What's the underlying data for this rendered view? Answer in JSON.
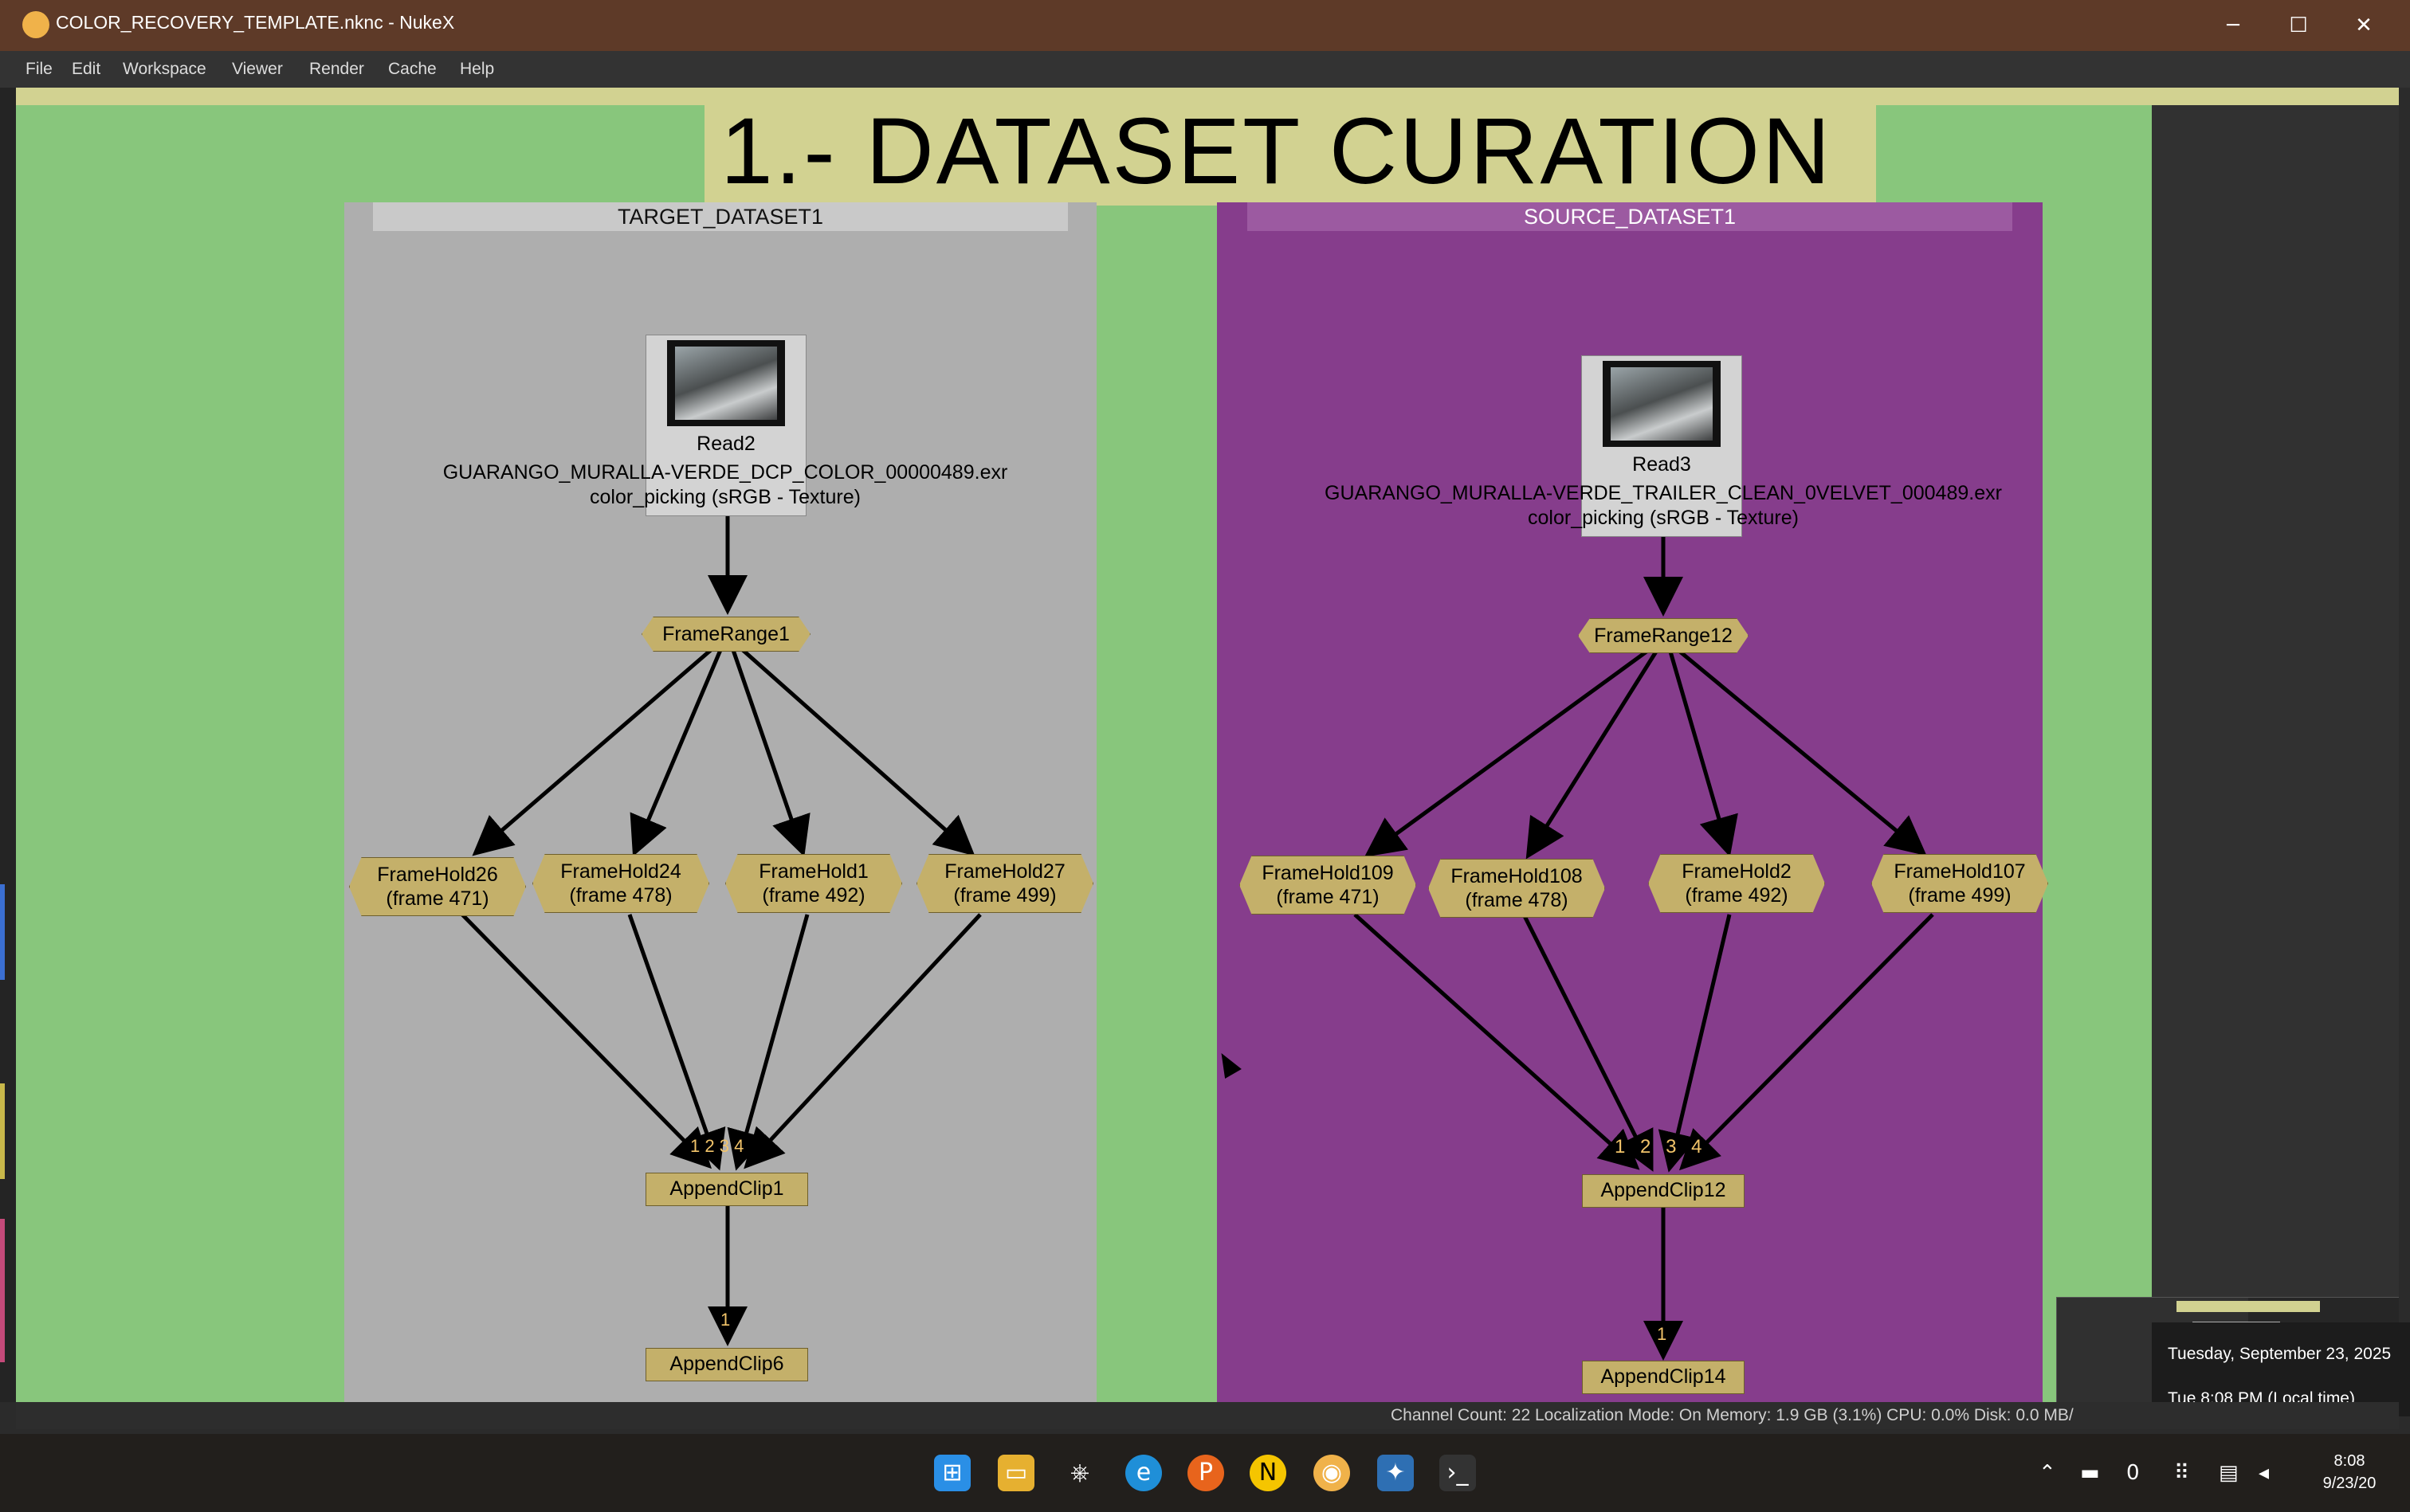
{
  "window": {
    "title": "COLOR_RECOVERY_TEMPLATE.nknc - NukeX",
    "minimize": "─",
    "maximize": "☐",
    "close": "✕"
  },
  "menu": [
    "File",
    "Edit",
    "Workspace",
    "Viewer",
    "Render",
    "Cache",
    "Help"
  ],
  "graph": {
    "title": "1.- DATASET CURATION",
    "target": {
      "label": "TARGET_DATASET1",
      "read": {
        "name": "Read2",
        "file": "GUARANGO_MURALLA-VERDE_DCP_COLOR_00000489.exr",
        "colorspace": "color_picking (sRGB - Texture)"
      },
      "framerange": "FrameRange1",
      "holds": [
        {
          "name": "FrameHold26",
          "frame": "(frame 471)"
        },
        {
          "name": "FrameHold24",
          "frame": "(frame 478)"
        },
        {
          "name": "FrameHold1",
          "frame": "(frame 492)"
        },
        {
          "name": "FrameHold27",
          "frame": "(frame 499)"
        }
      ],
      "inputs": [
        "1",
        "2",
        "3",
        "4"
      ],
      "append1": "AppendClip1",
      "append2": "AppendClip6",
      "append2_input": "1"
    },
    "source": {
      "label": "SOURCE_DATASET1",
      "read": {
        "name": "Read3",
        "file": "GUARANGO_MURALLA-VERDE_TRAILER_CLEAN_0VELVET_000489.exr",
        "colorspace": "color_picking (sRGB - Texture)"
      },
      "framerange": "FrameRange12",
      "holds": [
        {
          "name": "FrameHold109",
          "frame": "(frame 471)"
        },
        {
          "name": "FrameHold108",
          "frame": "(frame 478)"
        },
        {
          "name": "FrameHold2",
          "frame": "(frame 492)"
        },
        {
          "name": "FrameHold107",
          "frame": "(frame 499)"
        }
      ],
      "inputs": [
        "1",
        "2",
        "3",
        "4"
      ],
      "append1": "AppendClip12",
      "append2": "AppendClip14",
      "append2_input": "1"
    }
  },
  "status": "Channel Count: 22  Localization Mode: On  Memory: 1.9 GB (3.1%)  CPU: 0.0%  Disk: 0.0 MB/",
  "date_flyout": {
    "date": "Tuesday, September 23, 2025",
    "time": "Tue 8:08 PM (Local time)"
  },
  "tray": {
    "badge": "0"
  },
  "clock": {
    "time": "8:08",
    "date": "9/23/20"
  },
  "colors": {
    "title_bg": "#5e3a28",
    "green_bg": "#88c67c",
    "gray_backdrop": "#aeaeae",
    "purple_backdrop": "#863d8c",
    "node": "#c4b06a",
    "banner": "#d2d291"
  }
}
